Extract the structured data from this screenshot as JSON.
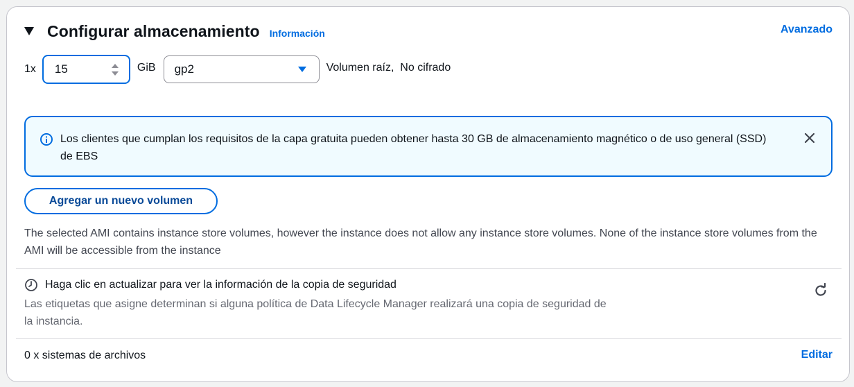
{
  "section": {
    "title": "Configurar almacenamiento",
    "info_link": "Información",
    "advanced_link": "Avanzado"
  },
  "volume": {
    "multiplier": "1x",
    "size_value": "15",
    "unit": "GiB",
    "type_selected": "gp2",
    "description": "Volumen raíz,  No cifrado"
  },
  "alert": {
    "text": "Los clientes que cumplan los requisitos de la capa gratuita pueden obtener hasta 30 GB de almacenamiento magnético o de uso general (SSD) de EBS"
  },
  "add_volume_button": "Agregar un nuevo volumen",
  "ami_note": "The selected AMI contains instance store volumes, however the instance does not allow any instance store volumes. None of the instance store volumes from the AMI will be accessible from the instance",
  "backup": {
    "title": "Haga clic en actualizar para ver la información de la copia de seguridad",
    "description": "Las etiquetas que asigne determinan si alguna política de Data Lifecycle Manager realizará una copia de seguridad de la instancia."
  },
  "file_systems": {
    "label": "0 x sistemas de archivos",
    "edit_link": "Editar"
  },
  "colors": {
    "accent": "#006ce0",
    "alert_background": "#f0fbff",
    "secondary_text": "#656871"
  },
  "icons": {
    "caret": "caret-down-icon",
    "stepper": "stepper-icon",
    "dropdown": "dropdown-caret-icon",
    "info": "info-icon",
    "close": "close-icon",
    "clock": "clock-icon",
    "refresh": "refresh-icon"
  }
}
